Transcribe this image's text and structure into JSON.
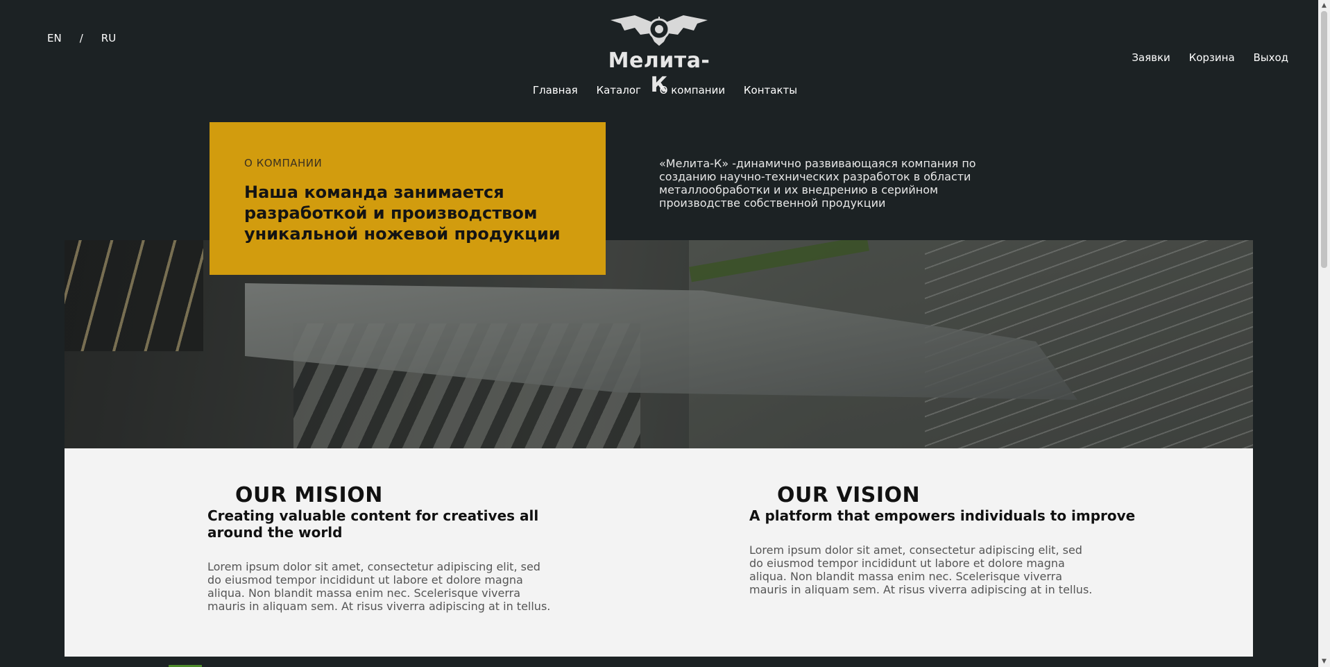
{
  "lang_switch": {
    "en": "EN",
    "separator": "/",
    "ru": "RU"
  },
  "logo": {
    "text": "Мелита-К"
  },
  "nav": {
    "items": [
      "Главная",
      "Каталог",
      "О компании",
      "Контакты"
    ]
  },
  "user_menu": {
    "requests": "Заявки",
    "cart": "Корзина",
    "logout": "Выход"
  },
  "about": {
    "kicker": "О КОМПАНИИ",
    "heading": "Наша команда занимается разработкой и производством уникальной ножевой продукции",
    "description": "«Мелита-К» -динамично развивающаяся компания по созданию научно-технических разработок в области металлообработки и их внедрению в серийном производстве собственной продукции"
  },
  "mission": {
    "title": "OUR MISION",
    "subtitle": "Creating valuable content for creatives all around the world",
    "text": "Lorem ipsum dolor sit amet, consectetur adipiscing elit, sed do eiusmod tempor incididunt ut labore et dolore magna aliqua. Non blandit massa enim nec. Scelerisque viverra mauris in aliquam sem. At risus viverra adipiscing at in tellus."
  },
  "vision": {
    "title": "OUR VISION",
    "subtitle": "A platform that empowers individuals to improve",
    "text": "Lorem ipsum dolor sit amet, consectetur adipiscing elit, sed do eiusmod tempor incididunt ut labore et dolore magna aliqua. Non blandit massa enim nec. Scelerisque viverra mauris in aliquam sem. At risus viverra adipiscing at in tellus."
  },
  "colors": {
    "background": "#1c2224",
    "accent": "#d29c0e",
    "panel": "#f3f3f3"
  }
}
